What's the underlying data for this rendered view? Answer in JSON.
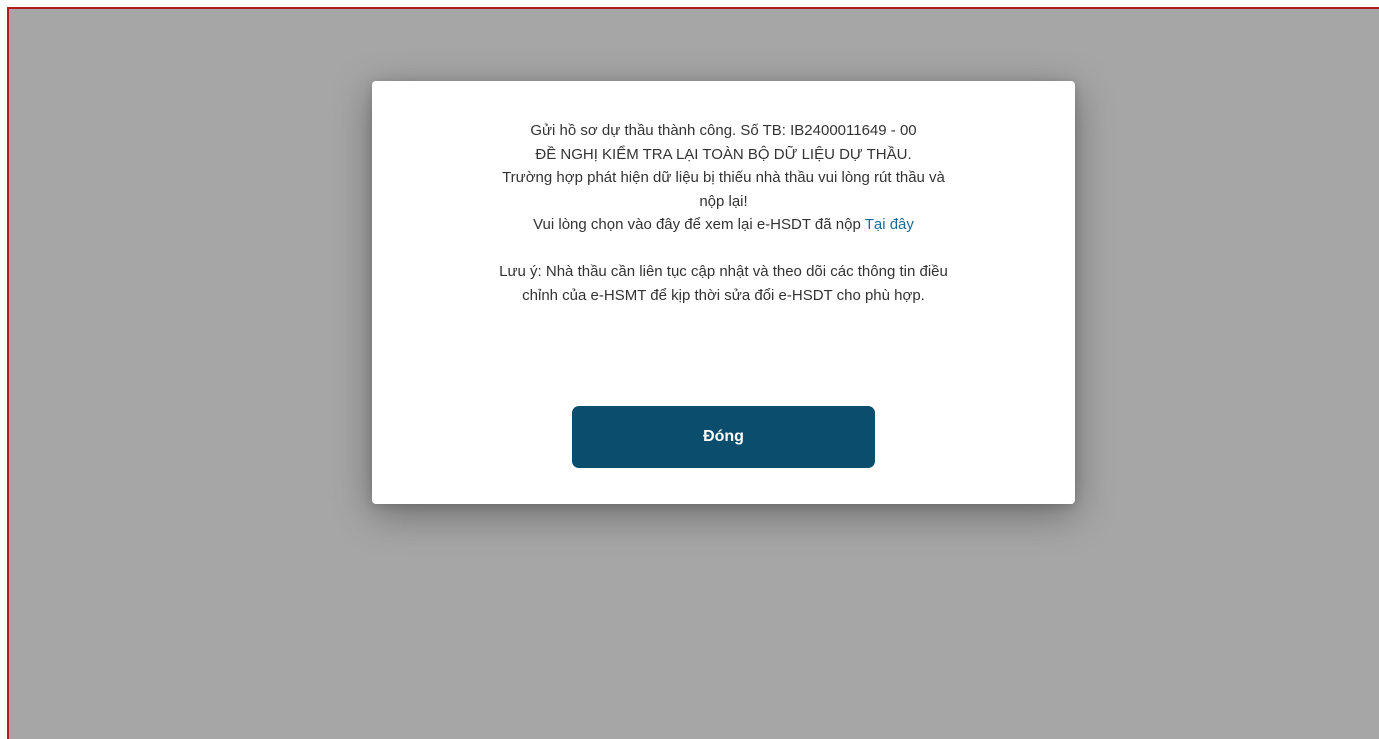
{
  "dialog": {
    "line1": "Gửi hồ sơ dự thầu thành công. Số TB: IB2400011649 - 00",
    "line2": "ĐỀ NGHỊ KIỂM TRA LẠI TOÀN BỘ DỮ LIỆU DỰ THẦU.",
    "line3": "Trường hợp phát hiện dữ liệu bị thiếu nhà thầu vui lòng rút thầu và",
    "line4": "nộp lại!",
    "line5_prefix": "Vui lòng chọn vào đây để xem lại e-HSDT đã nộp ",
    "line5_link": "Tại đây",
    "note_line1": "Lưu ý: Nhà thầu cần liên tục cập nhật và theo dõi các thông tin điều",
    "note_line2": "chỉnh của e-HSMT để kịp thời sửa đổi e-HSDT cho phù hợp.",
    "close_label": "Đóng"
  },
  "colors": {
    "overlay": "#a6a6a6",
    "button": "#0b4d6c",
    "link": "#1d6a96",
    "frame_border": "#b31b1b"
  }
}
